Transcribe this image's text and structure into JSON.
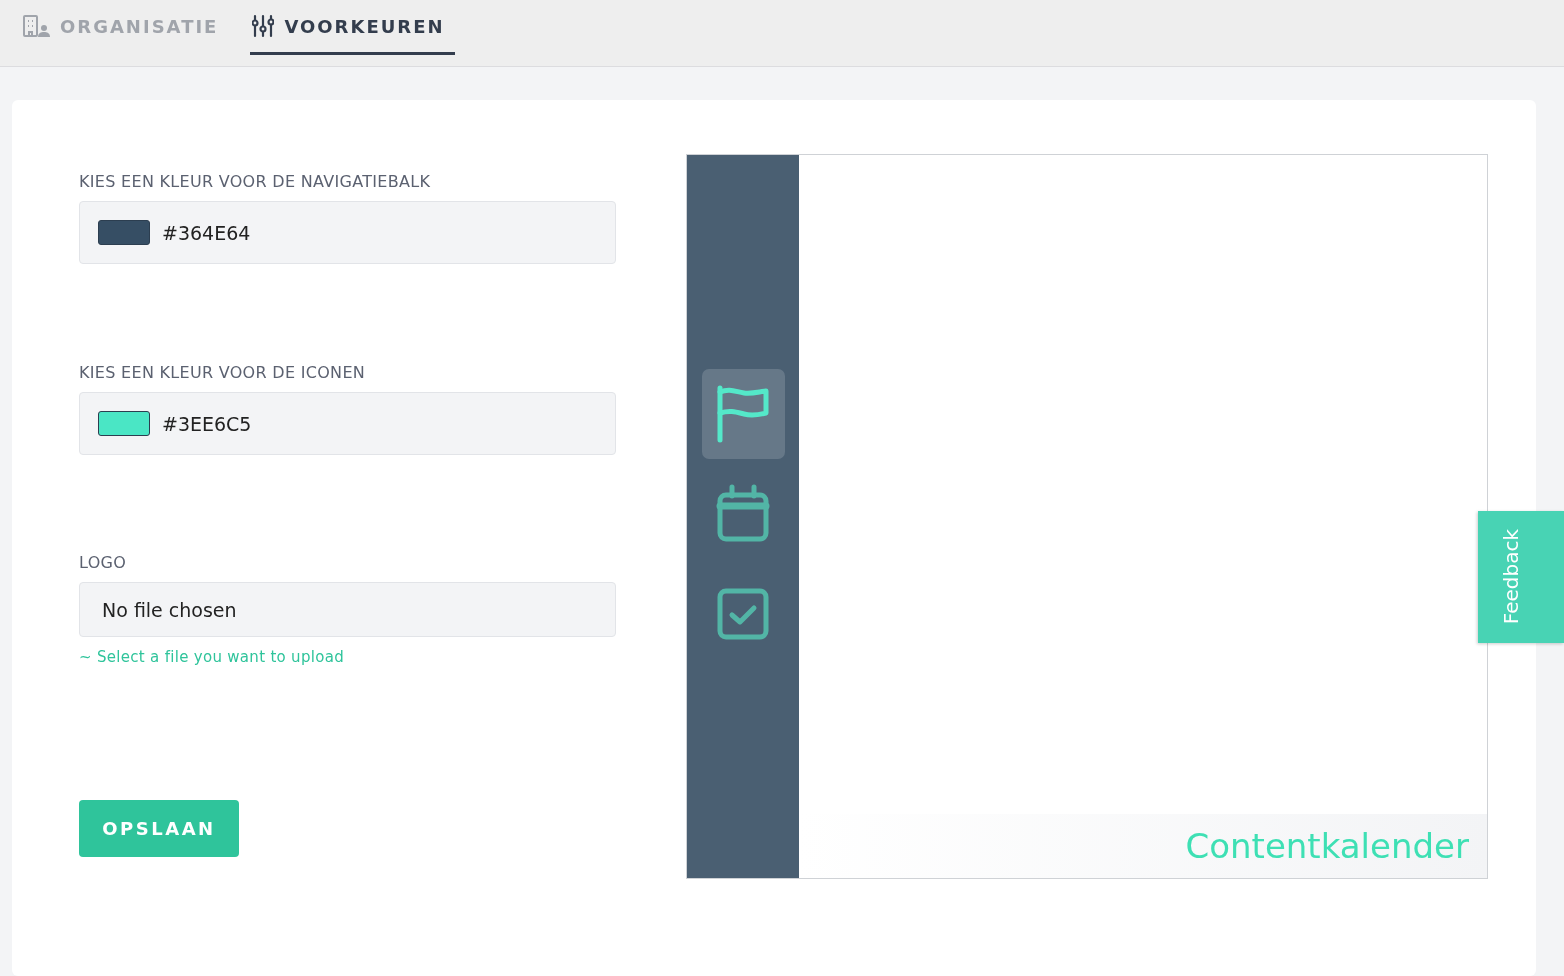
{
  "tabs": [
    {
      "label": "ORGANISATIE",
      "kind": "building",
      "selected": false
    },
    {
      "label": "VOORKEUREN",
      "kind": "sliders",
      "selected": true
    }
  ],
  "form": {
    "fields": [
      {
        "kind": "color",
        "label": "KIES EEN KLEUR VOOR DE NAVIGATIEBALK",
        "value": "#364E64",
        "color": "#364e64"
      },
      {
        "kind": "color",
        "label": "KIES EEN KLEUR VOOR DE ICONEN",
        "value": "#3EE6C5",
        "color": "#4ae6c5"
      },
      {
        "kind": "file",
        "label": "LOGO",
        "value": "No file chosen",
        "hint": "~ Select a file you want to upload"
      }
    ],
    "save_button": "OPSLAAN"
  },
  "preview": {
    "nav_items": [
      {
        "kind": "flag",
        "selected": true
      },
      {
        "kind": "calendar",
        "selected": false
      },
      {
        "kind": "checkbox",
        "selected": false
      }
    ],
    "title": "Contentkalender"
  },
  "feedback": "Feedback"
}
